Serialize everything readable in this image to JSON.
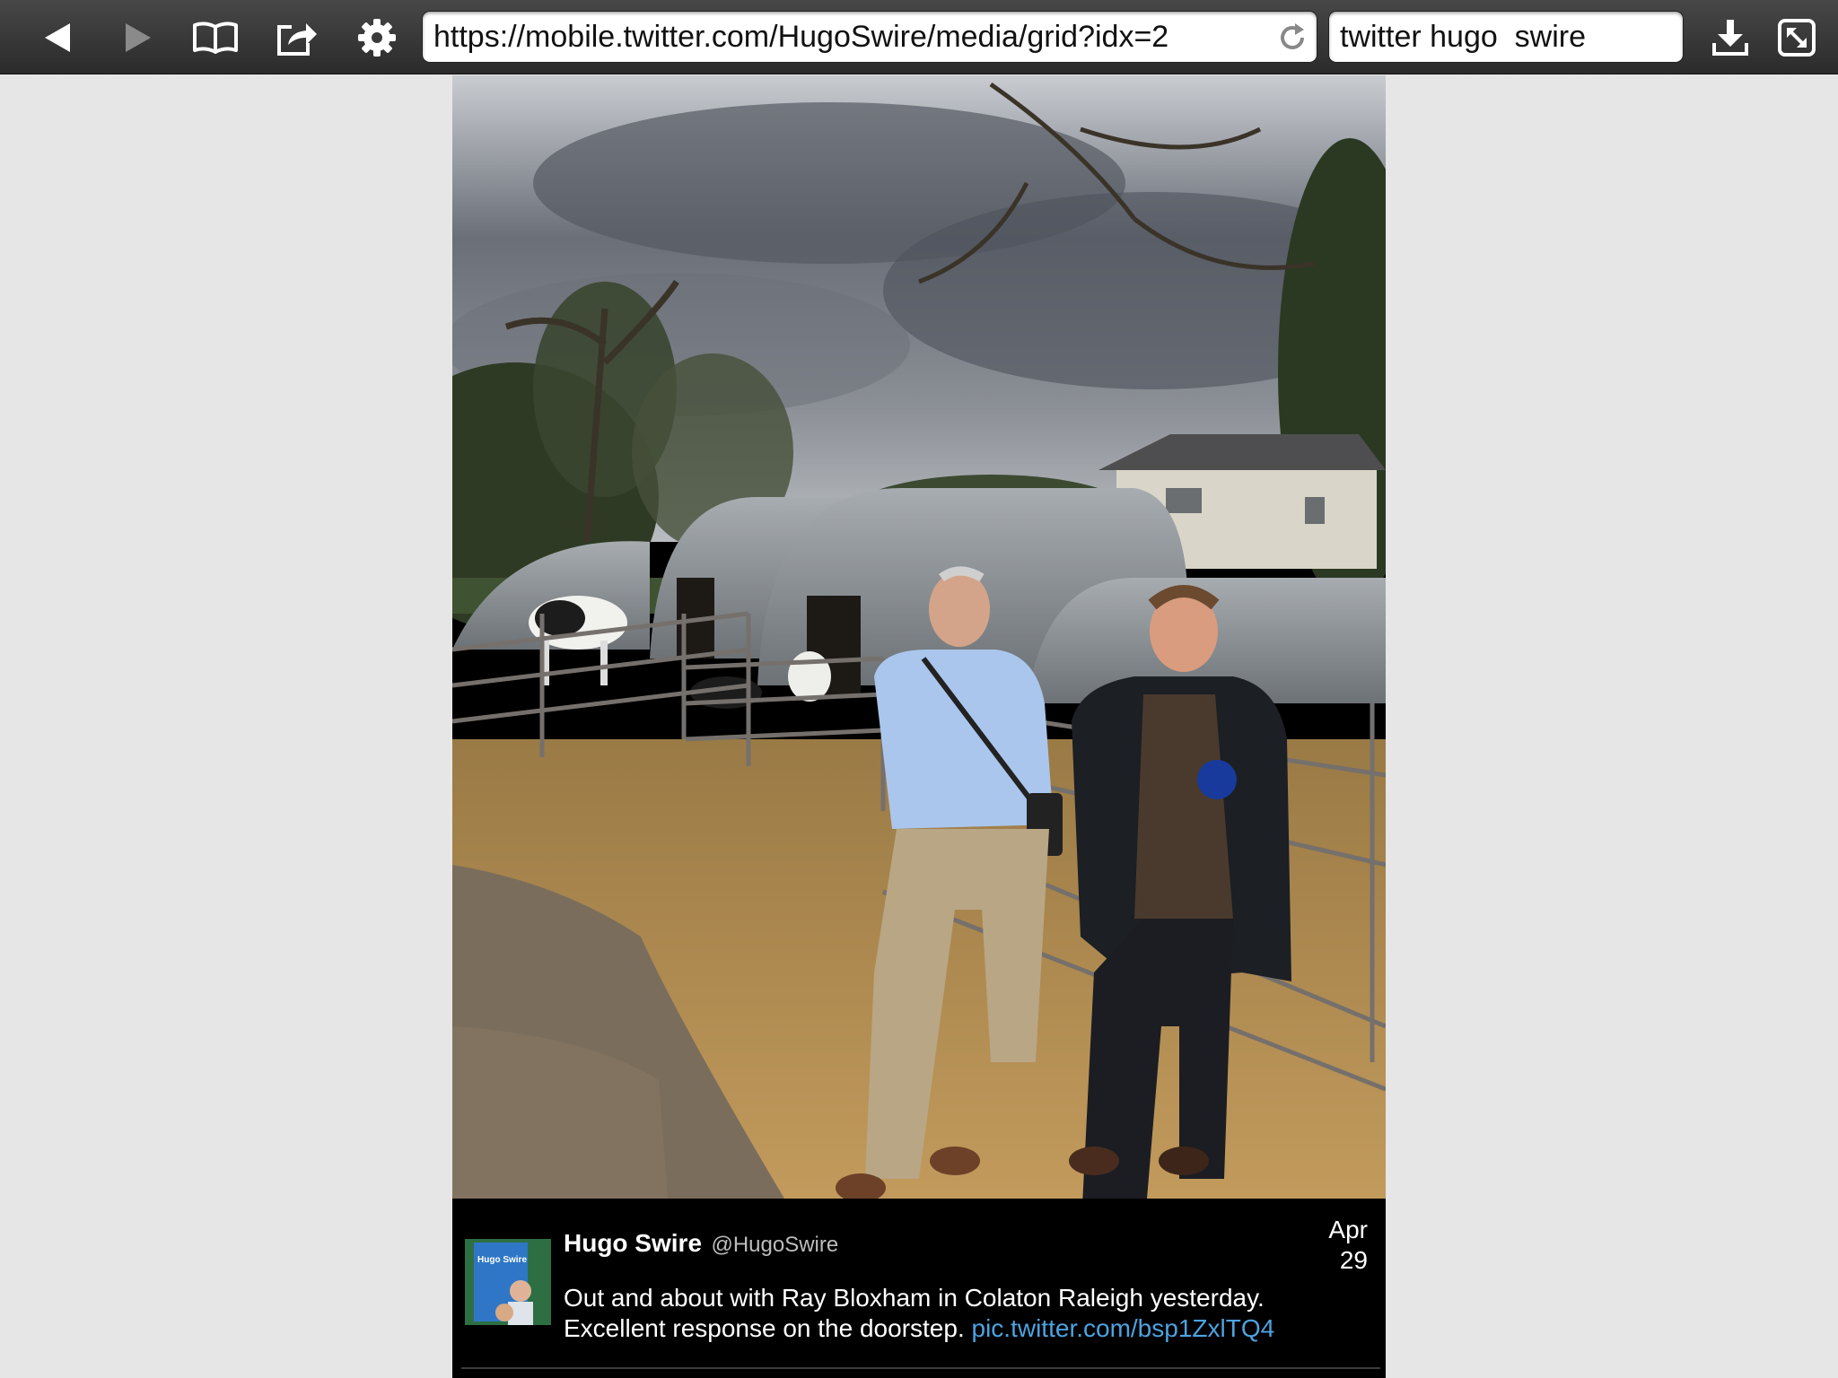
{
  "browser": {
    "url": "https://mobile.twitter.com/HugoSwire/media/grid?idx=2",
    "search_query": "twitter hugo  swire",
    "icons": [
      "back-icon",
      "forward-icon",
      "bookmarks-icon",
      "share-icon",
      "settings-icon",
      "reload-icon",
      "download-icon",
      "fullscreen-icon"
    ]
  },
  "tweet": {
    "display_name": "Hugo Swire",
    "handle": "@HugoSwire",
    "date_month": "Apr",
    "date_day": "29",
    "text_line1": "Out and about with Ray Bloxham in Colaton Raleigh yesterday.",
    "text_line2": "Excellent response on the doorstep.",
    "link_text": "pic.twitter.com/bsp1ZxlTQ4",
    "avatar_text": "Hugo Swire"
  },
  "colors": {
    "toolbar": "#3a3a3a",
    "page_background": "#e6e6e6",
    "tweet_background": "#000000",
    "link": "#4da3e0"
  }
}
